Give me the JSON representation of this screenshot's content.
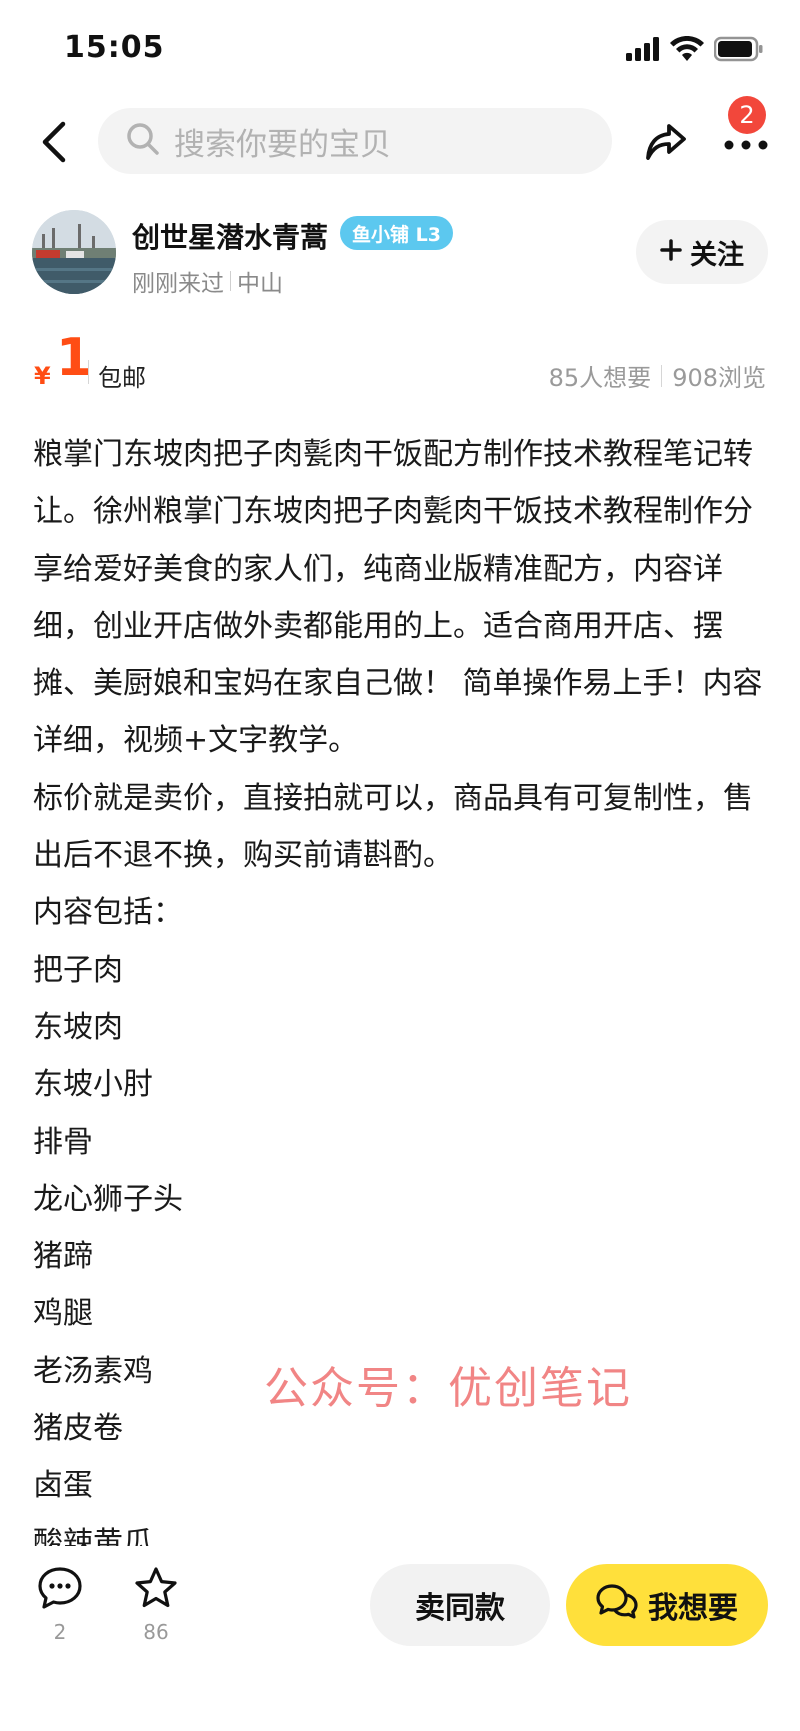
{
  "status_bar": {
    "time": "15:05",
    "icons": [
      "signal-icon",
      "wifi-icon",
      "battery-icon"
    ]
  },
  "top_bar": {
    "search_placeholder": "搜索你要的宝贝",
    "notification_count": "2",
    "icons": [
      "back-icon",
      "search-icon",
      "share-icon",
      "more-icon"
    ]
  },
  "seller": {
    "name": "创世星潜水青蒿",
    "level_badge": "鱼小铺 L3",
    "last_seen": "刚刚来过",
    "location": "中山",
    "follow_label": "关注"
  },
  "price": {
    "symbol": "¥",
    "value": "1",
    "shipping": "包邮",
    "want_count": "85人想要",
    "views": "908浏览",
    "color": "#ff4d14"
  },
  "description": [
    "粮掌门东坡肉把子肉甏肉干饭配方制作技术教程笔记转让。徐州粮掌门东坡肉把子肉甏肉干饭技术教程制作分享给爱好美食的家人们，纯商业版精准配方，内容详细，创业开店做外卖都能用的上。适合商用开店、摆摊、美厨娘和宝妈在家自己做！ 简单操作易上手！内容详细，视频+文字教学。",
    "标价就是卖价，直接拍就可以，商品具有可复制性，售出后不退不换，购买前请斟酌。",
    "内容包括：",
    "把子肉",
    "东坡肉",
    "东坡小肘",
    "排骨",
    "龙心狮子头",
    "猪蹄",
    "鸡腿",
    "老汤素鸡",
    "猪皮卷",
    "卤蛋",
    "酸辣黄瓜"
  ],
  "watermark": "公众号：优创笔记",
  "bottom_bar": {
    "comment_count": "2",
    "favorite_count": "86",
    "sell_same_label": "卖同款",
    "want_label": "我想要",
    "want_color": "#ffe03b"
  }
}
